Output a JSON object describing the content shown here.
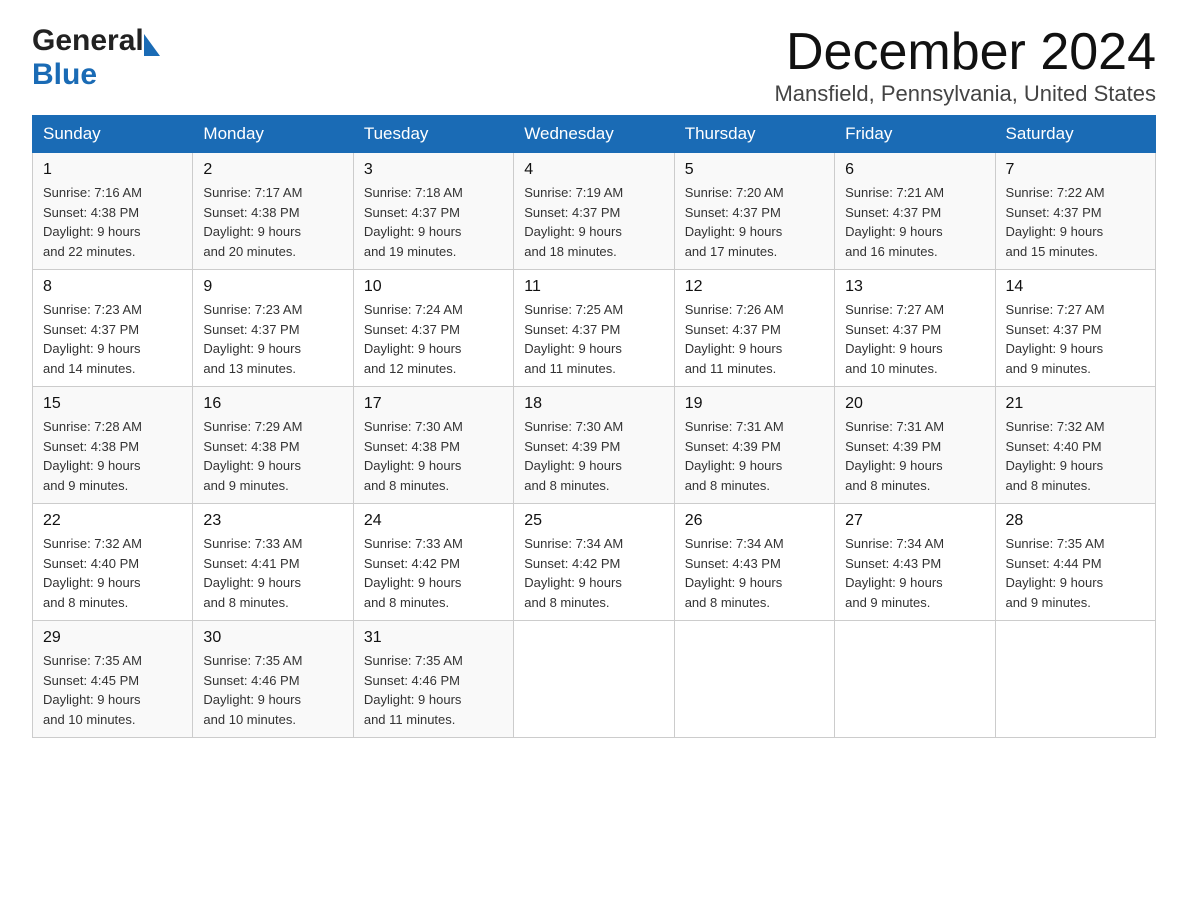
{
  "logo": {
    "general": "General",
    "blue": "Blue"
  },
  "title": "December 2024",
  "subtitle": "Mansfield, Pennsylvania, United States",
  "days_of_week": [
    "Sunday",
    "Monday",
    "Tuesday",
    "Wednesday",
    "Thursday",
    "Friday",
    "Saturday"
  ],
  "weeks": [
    [
      {
        "day": "1",
        "info": "Sunrise: 7:16 AM\nSunset: 4:38 PM\nDaylight: 9 hours\nand 22 minutes."
      },
      {
        "day": "2",
        "info": "Sunrise: 7:17 AM\nSunset: 4:38 PM\nDaylight: 9 hours\nand 20 minutes."
      },
      {
        "day": "3",
        "info": "Sunrise: 7:18 AM\nSunset: 4:37 PM\nDaylight: 9 hours\nand 19 minutes."
      },
      {
        "day": "4",
        "info": "Sunrise: 7:19 AM\nSunset: 4:37 PM\nDaylight: 9 hours\nand 18 minutes."
      },
      {
        "day": "5",
        "info": "Sunrise: 7:20 AM\nSunset: 4:37 PM\nDaylight: 9 hours\nand 17 minutes."
      },
      {
        "day": "6",
        "info": "Sunrise: 7:21 AM\nSunset: 4:37 PM\nDaylight: 9 hours\nand 16 minutes."
      },
      {
        "day": "7",
        "info": "Sunrise: 7:22 AM\nSunset: 4:37 PM\nDaylight: 9 hours\nand 15 minutes."
      }
    ],
    [
      {
        "day": "8",
        "info": "Sunrise: 7:23 AM\nSunset: 4:37 PM\nDaylight: 9 hours\nand 14 minutes."
      },
      {
        "day": "9",
        "info": "Sunrise: 7:23 AM\nSunset: 4:37 PM\nDaylight: 9 hours\nand 13 minutes."
      },
      {
        "day": "10",
        "info": "Sunrise: 7:24 AM\nSunset: 4:37 PM\nDaylight: 9 hours\nand 12 minutes."
      },
      {
        "day": "11",
        "info": "Sunrise: 7:25 AM\nSunset: 4:37 PM\nDaylight: 9 hours\nand 11 minutes."
      },
      {
        "day": "12",
        "info": "Sunrise: 7:26 AM\nSunset: 4:37 PM\nDaylight: 9 hours\nand 11 minutes."
      },
      {
        "day": "13",
        "info": "Sunrise: 7:27 AM\nSunset: 4:37 PM\nDaylight: 9 hours\nand 10 minutes."
      },
      {
        "day": "14",
        "info": "Sunrise: 7:27 AM\nSunset: 4:37 PM\nDaylight: 9 hours\nand 9 minutes."
      }
    ],
    [
      {
        "day": "15",
        "info": "Sunrise: 7:28 AM\nSunset: 4:38 PM\nDaylight: 9 hours\nand 9 minutes."
      },
      {
        "day": "16",
        "info": "Sunrise: 7:29 AM\nSunset: 4:38 PM\nDaylight: 9 hours\nand 9 minutes."
      },
      {
        "day": "17",
        "info": "Sunrise: 7:30 AM\nSunset: 4:38 PM\nDaylight: 9 hours\nand 8 minutes."
      },
      {
        "day": "18",
        "info": "Sunrise: 7:30 AM\nSunset: 4:39 PM\nDaylight: 9 hours\nand 8 minutes."
      },
      {
        "day": "19",
        "info": "Sunrise: 7:31 AM\nSunset: 4:39 PM\nDaylight: 9 hours\nand 8 minutes."
      },
      {
        "day": "20",
        "info": "Sunrise: 7:31 AM\nSunset: 4:39 PM\nDaylight: 9 hours\nand 8 minutes."
      },
      {
        "day": "21",
        "info": "Sunrise: 7:32 AM\nSunset: 4:40 PM\nDaylight: 9 hours\nand 8 minutes."
      }
    ],
    [
      {
        "day": "22",
        "info": "Sunrise: 7:32 AM\nSunset: 4:40 PM\nDaylight: 9 hours\nand 8 minutes."
      },
      {
        "day": "23",
        "info": "Sunrise: 7:33 AM\nSunset: 4:41 PM\nDaylight: 9 hours\nand 8 minutes."
      },
      {
        "day": "24",
        "info": "Sunrise: 7:33 AM\nSunset: 4:42 PM\nDaylight: 9 hours\nand 8 minutes."
      },
      {
        "day": "25",
        "info": "Sunrise: 7:34 AM\nSunset: 4:42 PM\nDaylight: 9 hours\nand 8 minutes."
      },
      {
        "day": "26",
        "info": "Sunrise: 7:34 AM\nSunset: 4:43 PM\nDaylight: 9 hours\nand 8 minutes."
      },
      {
        "day": "27",
        "info": "Sunrise: 7:34 AM\nSunset: 4:43 PM\nDaylight: 9 hours\nand 9 minutes."
      },
      {
        "day": "28",
        "info": "Sunrise: 7:35 AM\nSunset: 4:44 PM\nDaylight: 9 hours\nand 9 minutes."
      }
    ],
    [
      {
        "day": "29",
        "info": "Sunrise: 7:35 AM\nSunset: 4:45 PM\nDaylight: 9 hours\nand 10 minutes."
      },
      {
        "day": "30",
        "info": "Sunrise: 7:35 AM\nSunset: 4:46 PM\nDaylight: 9 hours\nand 10 minutes."
      },
      {
        "day": "31",
        "info": "Sunrise: 7:35 AM\nSunset: 4:46 PM\nDaylight: 9 hours\nand 11 minutes."
      },
      {
        "day": "",
        "info": ""
      },
      {
        "day": "",
        "info": ""
      },
      {
        "day": "",
        "info": ""
      },
      {
        "day": "",
        "info": ""
      }
    ]
  ]
}
